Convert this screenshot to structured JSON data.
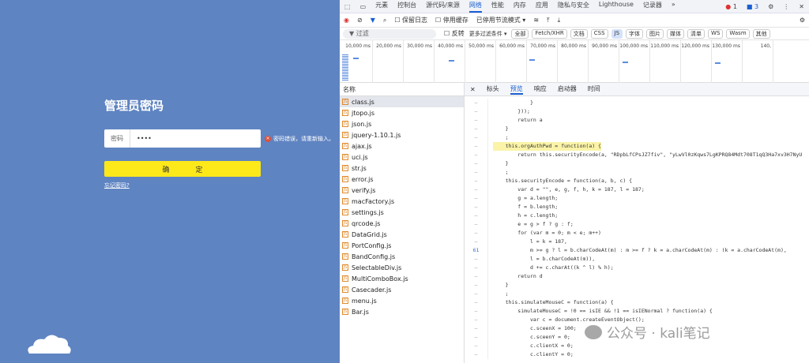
{
  "login": {
    "title": "管理员密码",
    "password_label": "密码",
    "password_value": "••••",
    "error": "密码错误，请重新输入。",
    "ok": "确　定",
    "forgot": "忘记密码?",
    "error_color": "#e0503a",
    "button_color": "#fde81a",
    "bg_color": "#5f84c2"
  },
  "devtools": {
    "tabs": [
      "元素",
      "控制台",
      "源代码/来源",
      "网络",
      "性能",
      "内存",
      "应用",
      "隐私与安全",
      "Lighthouse",
      "记录器",
      "»"
    ],
    "active_tab": "网络",
    "errors": "1",
    "messages": "3",
    "toolbar": {
      "preserve_log": "保留日志",
      "disable_cache": "停用缓存",
      "throttle": "已停用节流模式"
    },
    "filter": {
      "placeholder": "过滤",
      "invert": "反转",
      "more": "更多过滤条件 ▾",
      "chips": [
        "全部",
        "Fetch/XHR",
        "文档",
        "CSS",
        "JS",
        "字体",
        "图片",
        "媒体",
        "清单",
        "WS",
        "Wasm",
        "其他"
      ],
      "active_chip": "JS"
    },
    "timeline_ticks": [
      "10,000 ms",
      "20,000 ms",
      "30,000 ms",
      "40,000 ms",
      "50,000 ms",
      "60,000 ms",
      "70,000 ms",
      "80,000 ms",
      "90,000 ms",
      "100,000 ms",
      "110,000 ms",
      "120,000 ms",
      "130,000 ms",
      "140,"
    ],
    "files_header": "名称",
    "files": [
      "class.js",
      "jtopo.js",
      "json.js",
      "jquery-1.10.1.js",
      "ajax.js",
      "uci.js",
      "str.js",
      "error.js",
      "verify.js",
      "macFactory.js",
      "settings.js",
      "qrcode.js",
      "DataGrid.js",
      "PortConfig.js",
      "BandConfig.js",
      "SelectableDiv.js",
      "MultiComboBox.js",
      "Casecader.js",
      "menu.js",
      "Bar.js"
    ],
    "preview_tabs": [
      "标头",
      "预览",
      "响应",
      "启动器",
      "时间"
    ],
    "active_preview": "预览",
    "code": [
      {
        "g": "–",
        "t": "            }"
      },
      {
        "g": "–",
        "t": "        }));"
      },
      {
        "g": "–",
        "t": "        return a"
      },
      {
        "g": "–",
        "t": "    }"
      },
      {
        "g": "–",
        "t": "    ;"
      },
      {
        "g": "–",
        "t": "    this.orgAuthPwd = function(a) {",
        "hl": true
      },
      {
        "g": "–",
        "t": "        return this.securityEncode(a, \"RDpbLfCPsJZ7fiv\", \"yLwVl0zKqws7LgKPRQ84Mdt708T1qQ3Ha7xv3H7NyU"
      },
      {
        "g": "–",
        "t": "    }"
      },
      {
        "g": "–",
        "t": "    ;"
      },
      {
        "g": "–",
        "t": "    this.securityEncode = function(a, b, c) {"
      },
      {
        "g": "–",
        "t": "        var d = \"\", e, g, f, h, k = 187, l = 187;"
      },
      {
        "g": "–",
        "t": "        g = a.length;"
      },
      {
        "g": "–",
        "t": "        f = b.length;"
      },
      {
        "g": "–",
        "t": "        h = c.length;"
      },
      {
        "g": "–",
        "t": "        e = g > f ? g : f;"
      },
      {
        "g": "–",
        "t": "        for (var m = 0; m < e; m++)"
      },
      {
        "g": "–",
        "t": "            l = k = 187,"
      },
      {
        "g": "61",
        "t": "            m >= g ? l = b.charCodeAt(m) : m >= f ? k = a.charCodeAt(m) : (k = a.charCodeAt(m),"
      },
      {
        "g": "–",
        "t": "            l = b.charCodeAt(m)),"
      },
      {
        "g": "–",
        "t": "            d += c.charAt((k ^ l) % h);"
      },
      {
        "g": "–",
        "t": "        return d"
      },
      {
        "g": "–",
        "t": "    }"
      },
      {
        "g": "–",
        "t": "    ;"
      },
      {
        "g": "–",
        "t": "    this.simulateMouseC = function(a) {"
      },
      {
        "g": "–",
        "t": "        simulateMouseC = !0 == isIE && !1 == isIENormal ? function(a) {"
      },
      {
        "g": "–",
        "t": "            var c = document.createEventObject();"
      },
      {
        "g": "–",
        "t": "            c.sceenX = 100;"
      },
      {
        "g": "–",
        "t": "            c.sceenY = 0;"
      },
      {
        "g": "–",
        "t": "            c.clientX = 0;"
      },
      {
        "g": "–",
        "t": "            c.clientY = 0;"
      }
    ]
  },
  "watermark": "公众号 · kali笔记"
}
